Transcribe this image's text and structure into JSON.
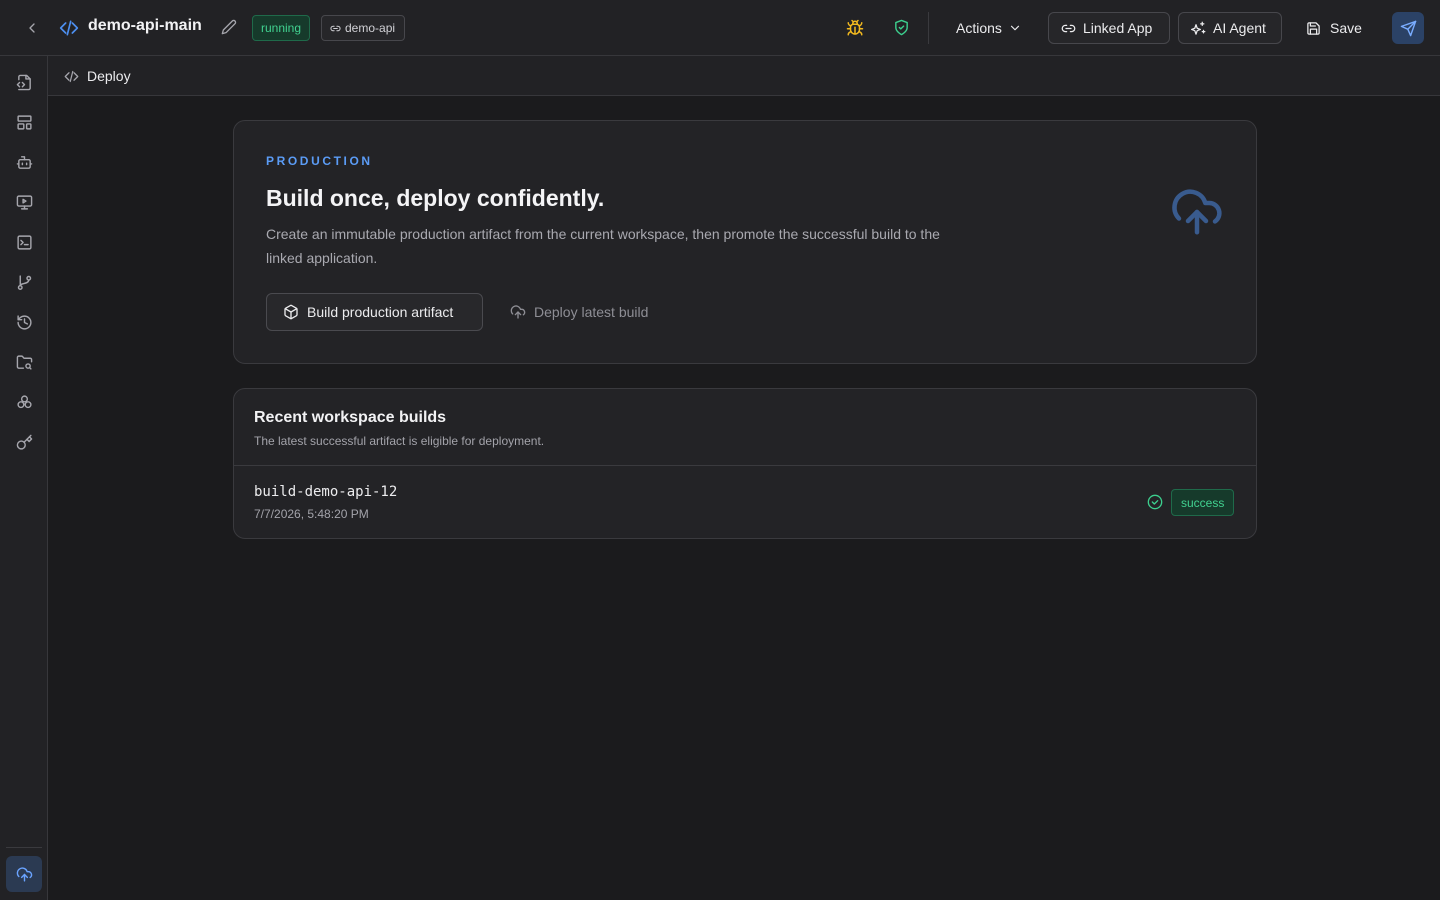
{
  "header": {
    "workspace_name": "demo-api-main",
    "status_badge": "running",
    "linked_badge": "demo-api",
    "actions_label": "Actions",
    "linked_app_label": "Linked App",
    "ai_agent_label": "AI Agent",
    "save_label": "Save"
  },
  "subheader": {
    "tab_label": "Deploy"
  },
  "sidebar": {
    "items": [
      {
        "icon": "file-code-icon"
      },
      {
        "icon": "layout-icon"
      },
      {
        "icon": "bot-icon"
      },
      {
        "icon": "monitor-play-icon"
      },
      {
        "icon": "terminal-icon"
      },
      {
        "icon": "git-branch-icon"
      },
      {
        "icon": "history-icon"
      },
      {
        "icon": "folder-search-icon"
      },
      {
        "icon": "components-icon"
      },
      {
        "icon": "key-icon"
      }
    ],
    "active_item": {
      "icon": "cloud-upload-icon"
    }
  },
  "production": {
    "eyebrow": "PRODUCTION",
    "title": "Build once, deploy confidently.",
    "description": "Create an immutable production artifact from the current workspace, then promote the successful build to the linked application.",
    "build_button": "Build production artifact",
    "deploy_button": "Deploy latest build"
  },
  "builds": {
    "title": "Recent workspace builds",
    "subtitle": "The latest successful artifact is eligible for deployment.",
    "rows": [
      {
        "name": "build-demo-api-12",
        "timestamp": "7/7/2026, 5:48:20 PM",
        "status": "success"
      }
    ]
  },
  "colors": {
    "background": "#1b1b1d",
    "panel": "#222225",
    "accent": "#5b9cf6",
    "success": "#41d190",
    "warning": "#f2b91f"
  }
}
